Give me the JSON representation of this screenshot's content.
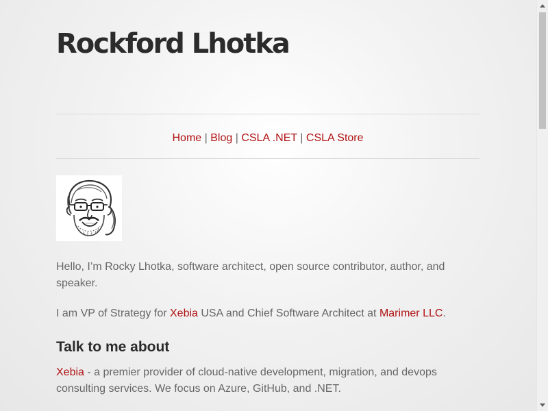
{
  "site": {
    "title": "Rockford Lhotka"
  },
  "nav": {
    "items": [
      {
        "label": "Home"
      },
      {
        "label": "Blog"
      },
      {
        "label": "CSLA .NET"
      },
      {
        "label": "CSLA Store"
      }
    ],
    "separator": "|"
  },
  "avatar": {
    "icon": "caricature-avatar-icon"
  },
  "intro": {
    "text": "Hello, I’m Rocky Lhotka, software architect, open source contributor, author, and speaker."
  },
  "role": {
    "prefix": "I am VP of Strategy for ",
    "link1": "Xebia",
    "middle": " USA and Chief Software Architect at ",
    "link2": "Marimer LLC",
    "suffix": "."
  },
  "talk": {
    "heading": "Talk to me about",
    "item1_link": "Xebia",
    "item1_text": " - a premier provider of cloud-native development, migration, and devops consulting services. We focus on Azure, GitHub, and .NET."
  },
  "colors": {
    "link": "#b01214",
    "text": "#666666",
    "heading": "#2b2b2b"
  }
}
